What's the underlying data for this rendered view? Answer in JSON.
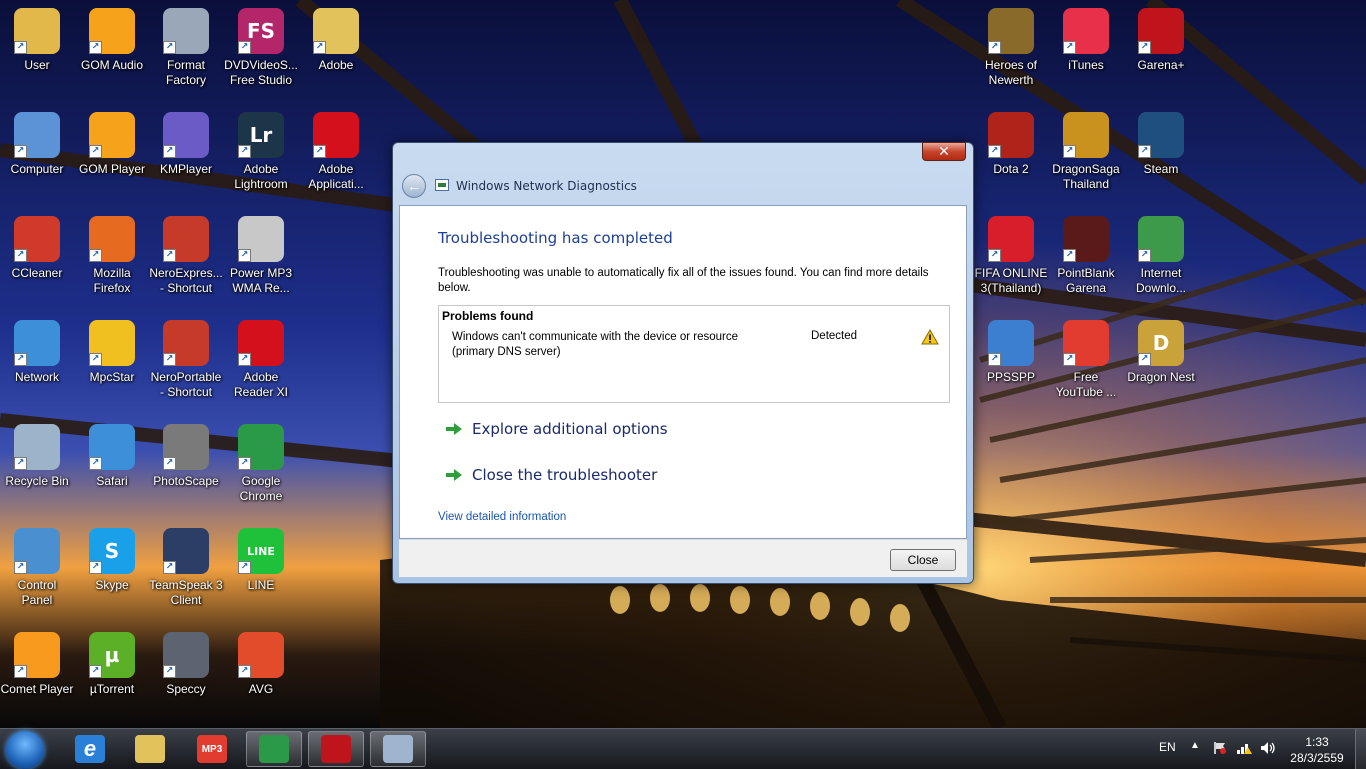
{
  "desktop": {
    "icons": [
      {
        "label": "User",
        "icon": "user-folder-icon",
        "color": "#e2b84a"
      },
      {
        "label": "GOM Audio",
        "icon": "gom-audio-icon",
        "color": "#f6a21a"
      },
      {
        "label": "Format\nFactory",
        "icon": "format-factory-icon",
        "color": "#9aa7b8"
      },
      {
        "label": "DVDVideoS...\nFree Studio",
        "icon": "dvdvideosoft-icon",
        "color": "#b4256a",
        "text": "FS"
      },
      {
        "label": "Adobe",
        "icon": "adobe-folder-icon",
        "color": "#e2c25a"
      },
      {
        "label": "Computer",
        "icon": "computer-icon",
        "color": "#5c92d6"
      },
      {
        "label": "GOM Player",
        "icon": "gom-player-icon",
        "color": "#f6a21a"
      },
      {
        "label": "KMPlayer",
        "icon": "kmplayer-icon",
        "color": "#6a5bc7"
      },
      {
        "label": "Adobe\nLightroom",
        "icon": "lightroom-icon",
        "color": "#1d3548",
        "text": "Lr"
      },
      {
        "label": "Adobe\nApplicati...",
        "icon": "adobe-application-icon",
        "color": "#d3101c"
      },
      {
        "label": "CCleaner",
        "icon": "ccleaner-icon",
        "color": "#cf3a2a"
      },
      {
        "label": "Mozilla\nFirefox",
        "icon": "firefox-icon",
        "color": "#e66a1f"
      },
      {
        "label": "NeroExpres...\n- Shortcut",
        "icon": "nero-express-icon",
        "color": "#c63a2a"
      },
      {
        "label": "Power MP3\nWMA Re...",
        "icon": "power-mp3-icon",
        "color": "#c8c8c8"
      },
      {
        "label": "Network",
        "icon": "network-icon",
        "color": "#3c8fd8"
      },
      {
        "label": "MpcStar",
        "icon": "mpcstar-icon",
        "color": "#f0c020"
      },
      {
        "label": "NeroPortable\n- Shortcut",
        "icon": "nero-portable-icon",
        "color": "#c63a2a"
      },
      {
        "label": "Adobe\nReader XI",
        "icon": "adobe-reader-icon",
        "color": "#d3101c"
      },
      {
        "label": "Recycle Bin",
        "icon": "recycle-bin-icon",
        "color": "#9db3c9"
      },
      {
        "label": "Safari",
        "icon": "safari-icon",
        "color": "#3c8fd8"
      },
      {
        "label": "PhotoScape",
        "icon": "photoscape-icon",
        "color": "#7a7a7a"
      },
      {
        "label": "Google\nChrome",
        "icon": "chrome-icon",
        "color": "#2a9a49"
      },
      {
        "label": "Control\nPanel",
        "icon": "control-panel-icon",
        "color": "#4a90d0"
      },
      {
        "label": "Skype",
        "icon": "skype-icon",
        "color": "#1aa0e8",
        "text": "S"
      },
      {
        "label": "TeamSpeak 3\nClient",
        "icon": "teamspeak-icon",
        "color": "#2c3e66"
      },
      {
        "label": "LINE",
        "icon": "line-icon",
        "color": "#1fc13a",
        "text": "LINE"
      },
      {
        "label": "Comet Player",
        "icon": "comet-player-icon",
        "color": "#f79a1e"
      },
      {
        "label": "µTorrent",
        "icon": "utorrent-icon",
        "color": "#5bb028",
        "text": "µ"
      },
      {
        "label": "Speccy",
        "icon": "speccy-icon",
        "color": "#5b6470"
      },
      {
        "label": "AVG",
        "icon": "avg-icon",
        "color": "#e34c2a"
      },
      {
        "label": "Heroes of\nNewerth",
        "icon": "heroes-of-newerth-icon",
        "color": "#8a6a2a"
      },
      {
        "label": "iTunes",
        "icon": "itunes-icon",
        "color": "#e8304a"
      },
      {
        "label": "Garena+",
        "icon": "garena-icon",
        "color": "#c0141c"
      },
      {
        "label": "Dota 2",
        "icon": "dota2-icon",
        "color": "#b0231a"
      },
      {
        "label": "DragonSaga\nThailand",
        "icon": "dragonsaga-icon",
        "color": "#c9921e"
      },
      {
        "label": "Steam",
        "icon": "steam-icon",
        "color": "#1f4f7e"
      },
      {
        "label": "FIFA ONLINE\n3(Thailand)",
        "icon": "fifa-online-icon",
        "color": "#d81e2a"
      },
      {
        "label": "PointBlank\nGarena",
        "icon": "pointblank-icon",
        "color": "#5a1a1a"
      },
      {
        "label": "Internet\nDownlo...",
        "icon": "idm-icon",
        "color": "#3c9a4a"
      },
      {
        "label": "PPSSPP",
        "icon": "ppsspp-icon",
        "color": "#3c7fd0"
      },
      {
        "label": "Free\nYouTube ...",
        "icon": "free-youtube-icon",
        "color": "#e23b2f"
      },
      {
        "label": "Dragon Nest",
        "icon": "dragon-nest-icon",
        "color": "#c9a23a",
        "text": "D"
      }
    ]
  },
  "dialog": {
    "title": "Windows Network Diagnostics",
    "close_glyph": "✕",
    "heading": "Troubleshooting has completed",
    "description": "Troubleshooting was unable to automatically fix all of the issues found. You can find more details below.",
    "problems_title": "Problems found",
    "problem": {
      "text": "Windows can't communicate with the device or resource (primary DNS server)",
      "status": "Detected"
    },
    "options": [
      "Explore additional options",
      "Close the troubleshooter"
    ],
    "detail_link": "View detailed information",
    "close_button": "Close"
  },
  "taskbar": {
    "pinned": [
      {
        "icon": "internet-explorer-icon",
        "color": "#2a7fd6",
        "text": "e"
      },
      {
        "icon": "windows-explorer-icon",
        "color": "#e2c25a",
        "text": ""
      },
      {
        "icon": "mp3-app-icon",
        "color": "#e23b2f",
        "text": "MP3"
      },
      {
        "icon": "chrome-taskbar-icon",
        "color": "#2a9a49",
        "text": ""
      },
      {
        "icon": "garena-taskbar-icon",
        "color": "#c0141c",
        "text": ""
      },
      {
        "icon": "network-diagnostics-taskbar-icon",
        "color": "#9fb4cf",
        "text": ""
      }
    ],
    "language": "EN",
    "time": "1:33",
    "date": "28/3/2559"
  }
}
